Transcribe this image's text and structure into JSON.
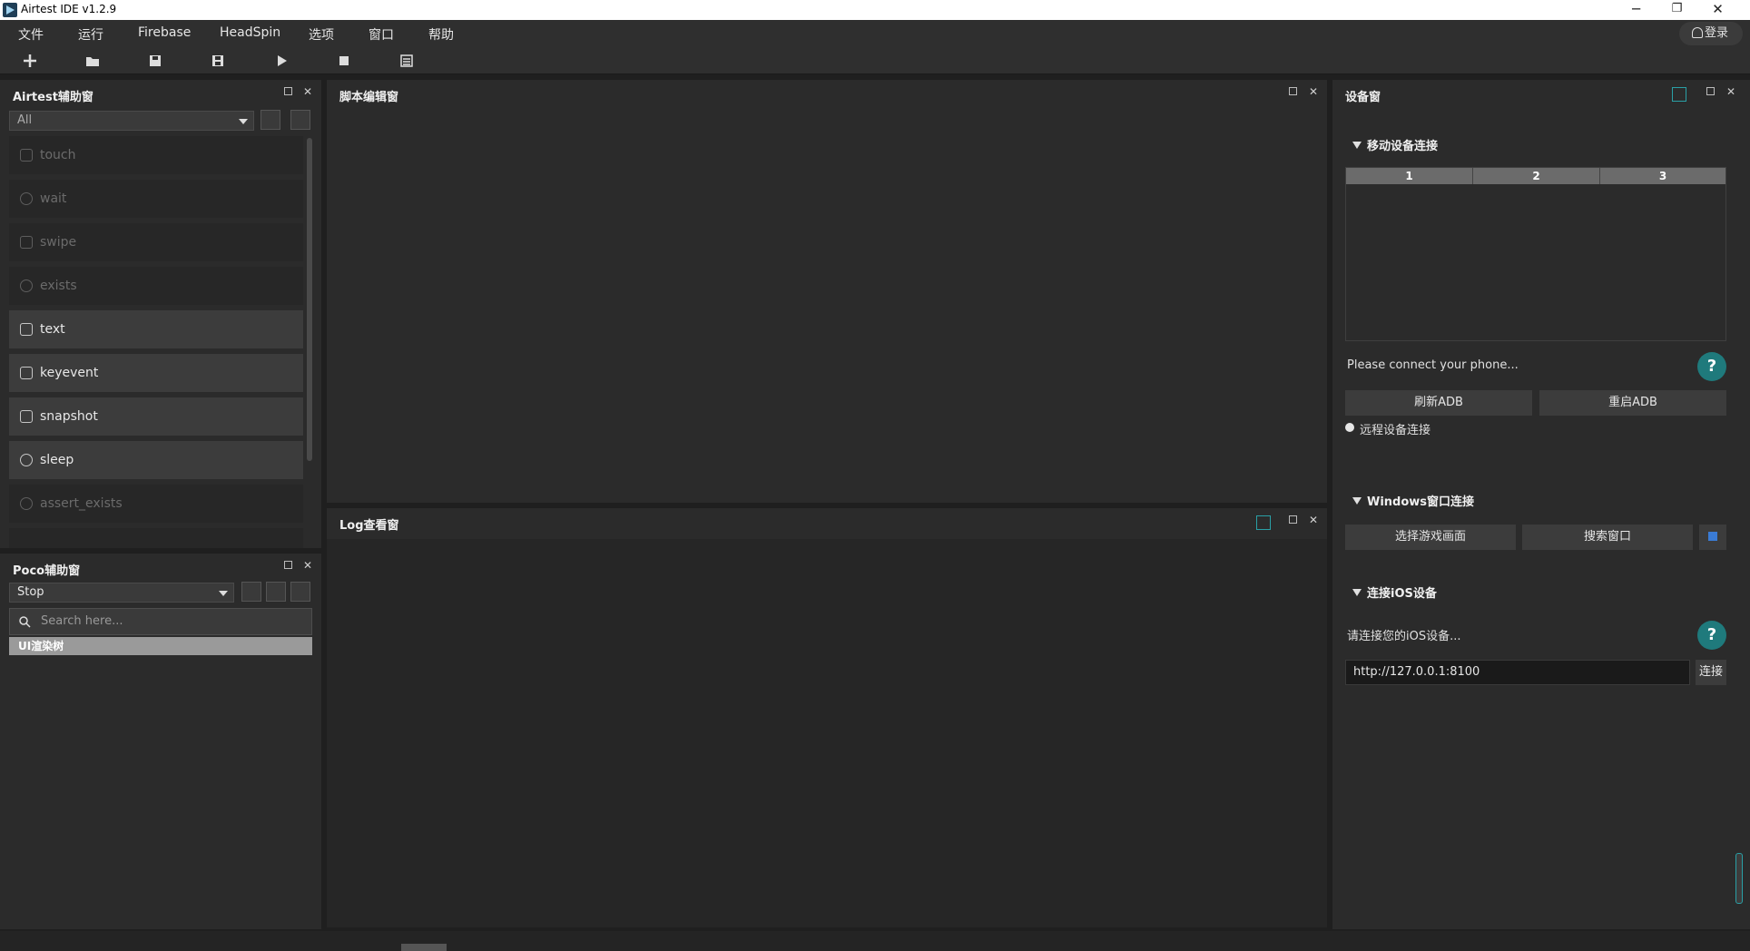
{
  "window": {
    "title": "Airtest IDE v1.2.9",
    "minimize": "─",
    "restore": "❐",
    "close": "✕"
  },
  "menu": [
    "文件",
    "运行",
    "Firebase",
    "HeadSpin",
    "选项",
    "窗口",
    "帮助"
  ],
  "login_label": "登录",
  "toolbar_icons": [
    "new-file-icon",
    "open-folder-icon",
    "save-icon",
    "save-as-icon",
    "run-icon",
    "stop-icon",
    "log-icon"
  ],
  "airtest_panel": {
    "title": "Airtest辅助窗",
    "filter_value": "All",
    "apis": [
      {
        "label": "touch",
        "enabled": false
      },
      {
        "label": "wait",
        "enabled": false
      },
      {
        "label": "swipe",
        "enabled": false
      },
      {
        "label": "exists",
        "enabled": false
      },
      {
        "label": "text",
        "enabled": true
      },
      {
        "label": "keyevent",
        "enabled": true
      },
      {
        "label": "snapshot",
        "enabled": true
      },
      {
        "label": "sleep",
        "enabled": true
      },
      {
        "label": "assert_exists",
        "enabled": false
      }
    ]
  },
  "poco_panel": {
    "title": "Poco辅助窗",
    "mode_value": "Stop",
    "search_placeholder": "Search here...",
    "tree_root": "UI渲染树"
  },
  "script_panel": {
    "title": "脚本编辑窗"
  },
  "log_panel": {
    "title": "Log查看窗"
  },
  "device_panel": {
    "title": "设备窗",
    "mobile_section": "移动设备连接",
    "table_columns": [
      "1",
      "2",
      "3"
    ],
    "status_text": "Please connect your phone...",
    "refresh_adb": "刷新ADB",
    "restart_adb": "重启ADB",
    "remote_connect": "远程设备连接",
    "windows_section": "Windows窗口连接",
    "select_game": "选择游戏画面",
    "search_window": "搜索窗口",
    "ios_section": "连接iOS设备",
    "ios_hint": "请连接您的iOS设备...",
    "ios_url": "http://127.0.0.1:8100",
    "connect": "连接"
  },
  "colors": {
    "help_teal": "#1f7a7c",
    "panel_bg": "#2b2b2b",
    "accent_blue": "#3a7bd5"
  }
}
